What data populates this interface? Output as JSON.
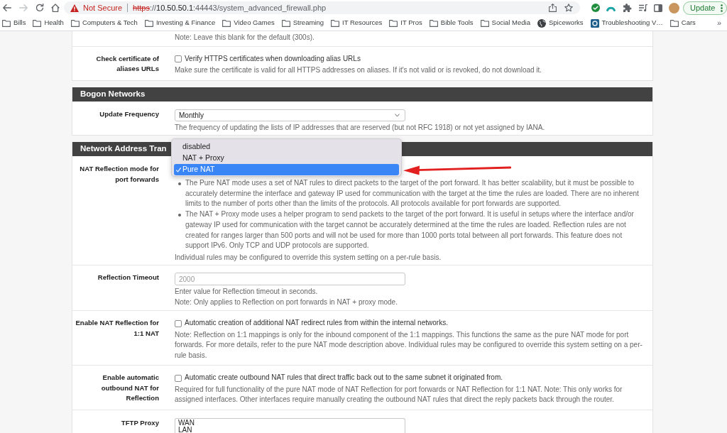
{
  "browser": {
    "security_label": "Not Secure",
    "url": [
      {
        "kind": "scheme",
        "text": "https"
      },
      {
        "kind": "rest",
        "text": "://"
      },
      {
        "kind": "host",
        "text": "10.50.50.1"
      },
      {
        "kind": "rest",
        "text": ":44443/system_advanced_firewall.php"
      }
    ],
    "update_button": "Update"
  },
  "bookmarks": {
    "items": [
      {
        "kind": "folder",
        "label": "Bills"
      },
      {
        "kind": "folder",
        "label": "Health"
      },
      {
        "kind": "folder",
        "label": "Computers & Tech"
      },
      {
        "kind": "folder",
        "label": "Investing & Finance"
      },
      {
        "kind": "folder",
        "label": "Video Games"
      },
      {
        "kind": "folder",
        "label": "Streaming"
      },
      {
        "kind": "folder",
        "label": "IT Resources"
      },
      {
        "kind": "folder",
        "label": "IT Pros"
      },
      {
        "kind": "folder",
        "label": "Bible Tools"
      },
      {
        "kind": "folder",
        "label": "Social Media"
      },
      {
        "kind": "site",
        "label": "Spiceworks"
      },
      {
        "kind": "app",
        "label": "Troubleshooting V…"
      },
      {
        "kind": "folder",
        "label": "Cars"
      }
    ],
    "overflow": "»"
  },
  "panels": [
    {
      "rows": [
        {
          "kind": "note",
          "help": [
            "Note: Leave this blank for the default (300s)."
          ]
        },
        {
          "kind": "checkbox",
          "label": "Check certificate of aliases URLs",
          "checked": false,
          "option": "Verify HTTPS certificates when downloading alias URLs",
          "help": [
            "Make sure the certificate is valid for all HTTPS addresses on aliases. If it's not valid or is revoked, do not download it."
          ]
        }
      ]
    },
    {
      "title": "Bogon Networks",
      "rows": [
        {
          "kind": "select",
          "label": "Update Frequency",
          "value": "Monthly",
          "help": [
            "The frequency of updating the lists of IP addresses that are reserved (but not RFC 1918) or not yet assigned by IANA."
          ]
        }
      ]
    },
    {
      "title": "Network Address Tran",
      "rows": [
        {
          "kind": "select",
          "label": "NAT Reflection mode for port forwards",
          "expanded": true,
          "options": [
            {
              "label": "disabled",
              "selected": false
            },
            {
              "label": "NAT + Proxy",
              "selected": false
            },
            {
              "label": "Pure NAT",
              "selected": true
            }
          ],
          "annotations": [
            {
              "kind": "arrow"
            }
          ],
          "bullets": [
            "The Pure NAT mode uses a set of NAT rules to direct packets to the target of the port forward. It has better scalability, but it must be possible to accurately determine the interface and gateway IP used for communication with the target at the time the rules are loaded. There are no inherent limits to the number of ports other than the limits of the protocols. All protocols available for port forwards are supported.",
            "The NAT + Proxy mode uses a helper program to send packets to the target of the port forward. It is useful in setups where the interface and/or gateway IP used for communication with the target cannot be accurately determined at the time the rules are loaded. Reflection rules are not created for ranges larger than 500 ports and will not be used for more than 1000 ports total between all port forwards. This feature does not support IPv6. Only TCP and UDP protocols are supported."
          ],
          "help": [
            "Individual rules may be configured to override this system setting on a per-rule basis."
          ]
        },
        {
          "kind": "input",
          "label": "Reflection Timeout",
          "placeholder": "2000",
          "help": [
            "Enter value for Reflection timeout in seconds.",
            "Note: Only applies to Reflection on port forwards in NAT + proxy mode."
          ]
        },
        {
          "kind": "checkbox",
          "label": "Enable NAT Reflection for 1:1 NAT",
          "checked": false,
          "option": "Automatic creation of additional NAT redirect rules from within the internal networks.",
          "help": [
            "Note: Reflection on 1:1 mappings is only for the inbound component of the 1:1 mappings. This functions the same as the pure NAT mode for port forwards. For more details, refer to the pure NAT mode description above. Individual rules may be configured to override this system setting on a per-rule basis."
          ]
        },
        {
          "kind": "checkbox",
          "label": "Enable automatic outbound NAT for Reflection",
          "checked": false,
          "option": "Automatic create outbound NAT rules that direct traffic back out to the same subnet it originated from.",
          "help": [
            "Required for full functionality of the pure NAT mode of NAT Reflection for port forwards or NAT Reflection for 1:1 NAT. Note: This only works for assigned interfaces. Other interfaces require manually creating the outbound NAT rules that direct the reply packets back through the router."
          ]
        },
        {
          "kind": "listbox",
          "label": "TFTP Proxy",
          "items": [
            "WAN",
            "LAN"
          ]
        }
      ]
    }
  ]
}
